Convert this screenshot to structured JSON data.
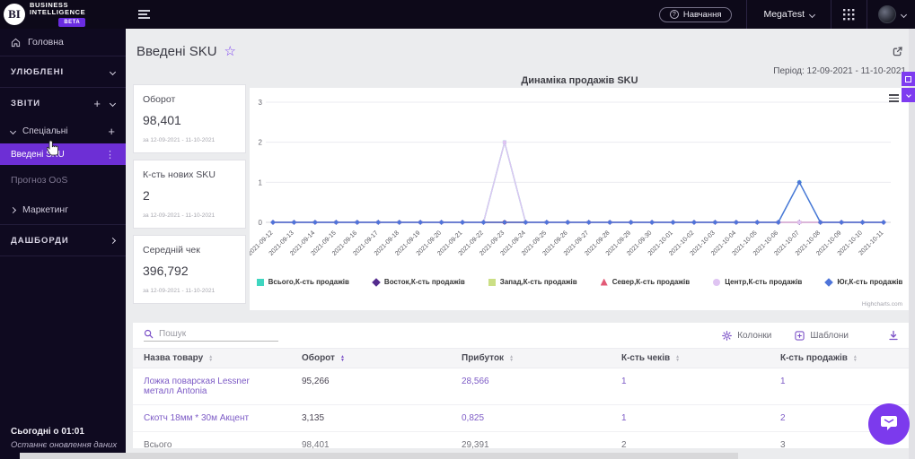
{
  "topbar": {
    "brand_initials": "BI",
    "brand_line1": "BUSINESS",
    "brand_line2": "INTELLIGENCE",
    "beta_badge": "BETA",
    "training_button": "Навчання",
    "workspace_name": "MegaTest"
  },
  "sidebar": {
    "home": "Головна",
    "favorites": "УЛЮБЛЕНІ",
    "reports": "ЗВІТИ",
    "special": "Спеціальні",
    "active_report": "Введені SKU",
    "oos": "Прогноз OoS",
    "marketing": "Маркетинг",
    "dashboards": "ДАШБОРДИ",
    "footer_time": "Сьогодні о 01:01",
    "footer_note": "Останнє оновлення даних"
  },
  "page": {
    "title": "Введені SKU",
    "period": "Період: 12-09-2021 - 11-10-2021"
  },
  "kpis": [
    {
      "label": "Оборот",
      "value": "98,401",
      "period": "за 12-09-2021 - 11-10-2021"
    },
    {
      "label": "К-сть нових SKU",
      "value": "2",
      "period": "за 12-09-2021 - 11-10-2021"
    },
    {
      "label": "Середній чек",
      "value": "396,792",
      "period": "за 12-09-2021 - 11-10-2021"
    }
  ],
  "chart_data": {
    "type": "line",
    "title": "Динаміка продажів SKU",
    "x": [
      "2021-09-12",
      "2021-09-13",
      "2021-09-14",
      "2021-09-15",
      "2021-09-16",
      "2021-09-17",
      "2021-09-18",
      "2021-09-19",
      "2021-09-20",
      "2021-09-21",
      "2021-09-22",
      "2021-09-23",
      "2021-09-24",
      "2021-09-25",
      "2021-09-26",
      "2021-09-27",
      "2021-09-28",
      "2021-09-29",
      "2021-09-30",
      "2021-10-01",
      "2021-10-02",
      "2021-10-03",
      "2021-10-04",
      "2021-10-05",
      "2021-10-06",
      "2021-10-07",
      "2021-10-08",
      "2021-10-09",
      "2021-10-10",
      "2021-10-11"
    ],
    "ylim": [
      0,
      3
    ],
    "yticks": [
      0,
      1,
      2,
      3
    ],
    "grid": true,
    "legend_position": "bottom",
    "series": [
      {
        "name": "Всього,К-сть продажів",
        "color": "#3fd6c0",
        "shape": "square",
        "values": [
          0,
          0,
          0,
          0,
          0,
          0,
          0,
          0,
          0,
          0,
          0,
          2,
          0,
          0,
          0,
          0,
          0,
          0,
          0,
          0,
          0,
          0,
          0,
          0,
          0,
          1,
          0,
          0,
          0,
          0
        ]
      },
      {
        "name": "Восток,К-сть продажів",
        "color": "#542c8e",
        "shape": "diamond",
        "values": [
          0,
          0,
          0,
          0,
          0,
          0,
          0,
          0,
          0,
          0,
          0,
          0,
          0,
          0,
          0,
          0,
          0,
          0,
          0,
          0,
          0,
          0,
          0,
          0,
          0,
          0,
          0,
          0,
          0,
          0
        ]
      },
      {
        "name": "Запад,К-сть продажів",
        "color": "#cbdf85",
        "shape": "square",
        "values": [
          0,
          0,
          0,
          0,
          0,
          0,
          0,
          0,
          0,
          0,
          0,
          0,
          0,
          0,
          0,
          0,
          0,
          0,
          0,
          0,
          0,
          0,
          0,
          0,
          0,
          0,
          0,
          0,
          0,
          0
        ]
      },
      {
        "name": "Север,К-сть продажів",
        "color": "#e25a76",
        "shape": "triangle",
        "values": [
          0,
          0,
          0,
          0,
          0,
          0,
          0,
          0,
          0,
          0,
          0,
          0,
          0,
          0,
          0,
          0,
          0,
          0,
          0,
          0,
          0,
          0,
          0,
          0,
          0,
          0,
          0,
          0,
          0,
          0
        ]
      },
      {
        "name": "Центр,К-сть продажів",
        "color": "#dfc4f2",
        "shape": "circle",
        "values": [
          0,
          0,
          0,
          0,
          0,
          0,
          0,
          0,
          0,
          0,
          0,
          2,
          0,
          0,
          0,
          0,
          0,
          0,
          0,
          0,
          0,
          0,
          0,
          0,
          0,
          0,
          0,
          0,
          0,
          0
        ]
      },
      {
        "name": "Юг,К-сть продажів",
        "color": "#4e74d9",
        "shape": "diamond",
        "values": [
          0,
          0,
          0,
          0,
          0,
          0,
          0,
          0,
          0,
          0,
          0,
          0,
          0,
          0,
          0,
          0,
          0,
          0,
          0,
          0,
          0,
          0,
          0,
          0,
          0,
          1,
          0,
          0,
          0,
          0
        ]
      }
    ]
  },
  "table": {
    "search_placeholder": "Пошук",
    "columns_button": "Колонки",
    "templates_button": "Шаблони",
    "headers": [
      "Назва товару",
      "Оборот",
      "Прибуток",
      "К-сть чеків",
      "К-сть продажів"
    ],
    "rows": [
      {
        "cells": [
          "Ложка поварская Lessner металл Antonia",
          "95,266",
          "28,566",
          "1",
          "1"
        ]
      },
      {
        "cells": [
          "Скотч 18мм * 30м Акцент",
          "3,135",
          "0,825",
          "1",
          "2"
        ]
      }
    ],
    "total_row": {
      "cells": [
        "Всього",
        "98,401",
        "29,391",
        "2",
        "3"
      ]
    }
  },
  "credit": "Highcharts.com"
}
